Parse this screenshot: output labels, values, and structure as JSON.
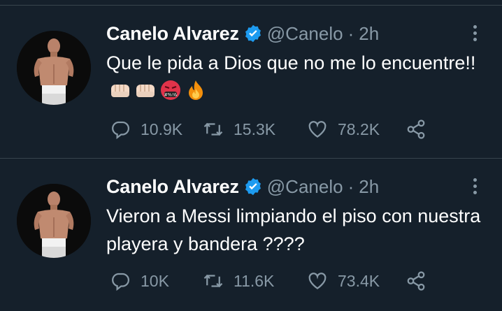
{
  "tweets": [
    {
      "name": "Canelo Alvarez",
      "handle": "@Canelo",
      "separator": "·",
      "time": "2h",
      "text": "Que le pida a Dios que no me lo encuentre!!",
      "emojis": [
        "fist-icon",
        "fist-icon",
        "angry-face-icon",
        "fire-icon"
      ],
      "replies": "10.9K",
      "retweets": "15.3K",
      "likes": "78.2K"
    },
    {
      "name": "Canelo Alvarez",
      "handle": "@Canelo",
      "separator": "·",
      "time": "2h",
      "text": "Vieron a Messi limpiando el piso con nuestra playera y bandera ????",
      "emojis": [],
      "replies": "10K",
      "retweets": "11.6K",
      "likes": "73.4K"
    }
  ],
  "colors": {
    "background": "#15202b",
    "divider": "#38444d",
    "muted": "#8899a6",
    "verified": "#1d9bf0"
  },
  "angry_face_text": "#%!&"
}
